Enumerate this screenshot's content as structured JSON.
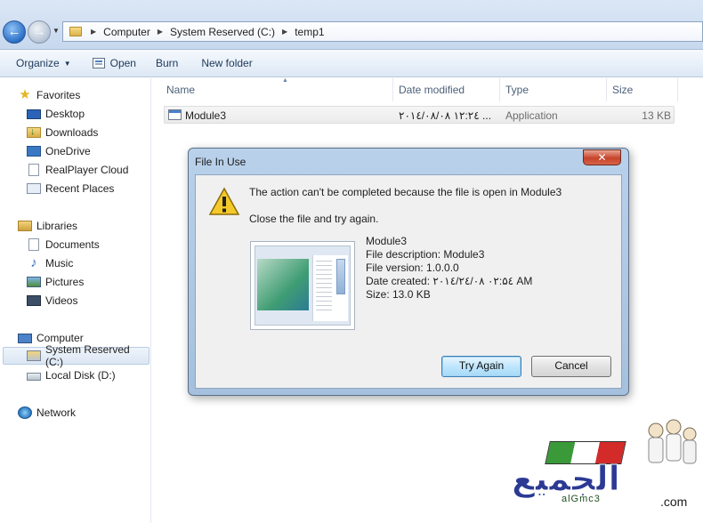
{
  "addressbar": {
    "breadcrumbs": [
      "Computer",
      "System Reserved (C:)",
      "temp1"
    ]
  },
  "toolbar": {
    "organize": "Organize",
    "open": "Open",
    "burn": "Burn",
    "new_folder": "New folder"
  },
  "nav": {
    "favorites": "Favorites",
    "desktop": "Desktop",
    "downloads": "Downloads",
    "onedrive": "OneDrive",
    "realplayer": "RealPlayer Cloud",
    "recent": "Recent Places",
    "libraries": "Libraries",
    "documents": "Documents",
    "music": "Music",
    "pictures": "Pictures",
    "videos": "Videos",
    "computer": "Computer",
    "system_reserved": "System Reserved (C:)",
    "local_disk": "Local Disk (D:)",
    "network": "Network"
  },
  "columns": {
    "name": "Name",
    "date_modified": "Date modified",
    "type": "Type",
    "size": "Size"
  },
  "file": {
    "name": "Module3",
    "date_modified": "۲۰۱٤/۰۸/۰۸ ۱۲:۲٤ ...",
    "type": "Application",
    "size": "13 KB"
  },
  "dialog": {
    "title": "File In Use",
    "close_glyph": "✕",
    "message": "The action can't be completed because the file is open in Module3",
    "instruction": "Close the file and try again.",
    "info_name": "Module3",
    "info_description": "File description: Module3",
    "info_version": "File version: 1.0.0.0",
    "info_created": "Date created: ۲۰۱٤/۲٤/۰۸ ۰۲:۵٤ AM",
    "info_size": "Size: 13.0 KB",
    "try_again": "Try Again",
    "cancel": "Cancel"
  },
  "watermark": {
    "arabic": "الجميع",
    "sub": "alGmc3",
    "domain": ".com"
  },
  "icons": {
    "back": "back-arrow-icon",
    "forward": "forward-arrow-icon",
    "warning": "warning-icon"
  },
  "colors": {
    "titlebar_accent": "#b9d1ea",
    "close_button": "#c7432a",
    "warning_yellow": "#f5c92a",
    "selection": "#dbe6f3"
  }
}
